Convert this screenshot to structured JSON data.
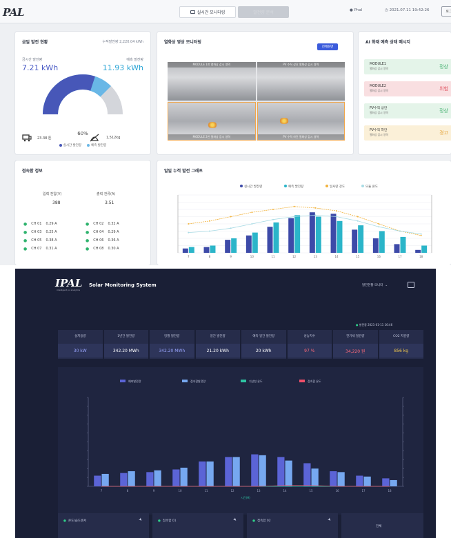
{
  "top": {
    "logo": "PAL",
    "tabs": [
      {
        "label": "실시간 모니터링",
        "active": true
      },
      {
        "label": "발전량 분석",
        "active": false
      }
    ],
    "user": "Phal",
    "datetime": "2021.07.11  19:42:26",
    "right_button": "로그",
    "generation": {
      "title": "금일 발전 현황",
      "total": "누적발전량 2,220.04 kWh",
      "current_label": "금시간 발전량",
      "current_value": "7.21 kWh",
      "predicted_label": "예측 발전량",
      "predicted_value": "11.93 kWh",
      "percent": "60%",
      "percent_value": 60,
      "legend": [
        "실시간 발전량",
        "예측 발전량"
      ],
      "co2": "23.38 톤",
      "tree": "1,512kg"
    },
    "camera": {
      "title": "열화상 영상 모니터링",
      "button": "전체화면",
      "cells": [
        "MODULE 1번 열화상 감시 영역",
        "PV 수직 상단 열화상 감시 영역",
        "MODULE 2번 열화상 감시 영역",
        "PV 수직 하단 열화상 감시 영역"
      ]
    },
    "ai": {
      "title": "AI 화재 예측 상태 메시지",
      "rows": [
        {
          "name": "MODULE1",
          "sub": "열화상 감시 영역",
          "state": "정상",
          "color": "#3fae6c",
          "bg": "#e4f4e9"
        },
        {
          "name": "MODULE2",
          "sub": "열화상 감시 영역",
          "state": "위험",
          "color": "#e05562",
          "bg": "#f9dfe1"
        },
        {
          "name": "PV수직 상단",
          "sub": "열화상 감시 영역",
          "state": "정상",
          "color": "#3fae6c",
          "bg": "#e4f4e9"
        },
        {
          "name": "PV수직 하단",
          "sub": "열화상 감시 영역",
          "state": "경고",
          "color": "#e5a43a",
          "bg": "#fbf0d8"
        }
      ]
    },
    "connection": {
      "title": "접속함 정보",
      "input_voltage_label": "입력 전압(V)",
      "input_voltage": "388",
      "output_current_label": "출력 전류(A)",
      "output_current": "3.51",
      "channels": [
        {
          "ch": "CH 01",
          "a": "0.29 A"
        },
        {
          "ch": "CH 02",
          "a": "0.32 A"
        },
        {
          "ch": "CH 03",
          "a": "0.25 A"
        },
        {
          "ch": "CH 04",
          "a": "0.29 A"
        },
        {
          "ch": "CH 05",
          "a": "0.38 A"
        },
        {
          "ch": "CH 06",
          "a": "0.36 A"
        },
        {
          "ch": "CH 07",
          "a": "0.31 A"
        },
        {
          "ch": "CH 08",
          "a": "0.30 A"
        }
      ]
    },
    "daily_chart_title": "일일 누적 발전 그래프"
  },
  "bottom": {
    "logo": "IPAL",
    "logo_sub": "intelligent pv analytics",
    "title": "Solar Monitoring System",
    "menu": "발전현황 모니터",
    "status": "발전중  2021-01-11  16:46",
    "stats": [
      {
        "label": "설치용량",
        "value": "30 kW",
        "color": "#9aa6ff"
      },
      {
        "label": "1년간 발전량",
        "value": "342.20 MWh",
        "color": "#ffffff"
      },
      {
        "label": "당월 발전량",
        "value": "342.20 MWh",
        "color": "#9aa6ff"
      },
      {
        "label": "일간 발전량",
        "value": "21.20 kWh",
        "color": "#ffffff"
      },
      {
        "label": "예측 일간 발전량",
        "value": "20 kWh",
        "color": "#ffffff"
      },
      {
        "label": "성능지수",
        "value": "97 %",
        "color": "#ff6a7a"
      },
      {
        "label": "전기세 절감량",
        "value": "34,220 원",
        "color": "#ff6a7a"
      },
      {
        "label": "CO2 저감량",
        "value": "856 kg",
        "color": "#f2c94c"
      }
    ],
    "footer": [
      {
        "label": "온도/습도센서"
      },
      {
        "label": "접속함 01"
      },
      {
        "label": "접속함 02"
      },
      {
        "label": "전체"
      }
    ]
  },
  "chart_data": [
    {
      "type": "bar",
      "title": "일일 누적 발전 그래프",
      "categories": [
        "7",
        "8",
        "9",
        "10",
        "11",
        "12",
        "13",
        "14",
        "15",
        "16",
        "17",
        "18"
      ],
      "legend": [
        "실시간 발전량",
        "예측 발전량",
        "일사량 강도",
        "모듈 온도"
      ],
      "series": [
        {
          "name": "실시간 발전량",
          "values": [
            3,
            4,
            9,
            12,
            18,
            24,
            28,
            27,
            16,
            10,
            6,
            2
          ],
          "color": "#3d4aa8"
        },
        {
          "name": "예측 발전량",
          "values": [
            4,
            5,
            10,
            14,
            21,
            26,
            25,
            22,
            19,
            15,
            11,
            5
          ],
          "color": "#2bb5c9"
        },
        {
          "name": "일사량 강도",
          "values": [
            20,
            22,
            25,
            28,
            30,
            32,
            31,
            29,
            25,
            20,
            15,
            12
          ],
          "color": "#f2b33d"
        },
        {
          "name": "모듈 온도",
          "values": [
            14,
            15,
            17,
            20,
            23,
            25,
            26,
            25,
            22,
            18,
            15,
            13
          ],
          "color": "#a9dbe5"
        }
      ],
      "ylim": [
        0,
        40
      ]
    },
    {
      "type": "bar",
      "categories": [
        "7",
        "8",
        "9",
        "10",
        "11",
        "12",
        "13",
        "14",
        "15",
        "16",
        "17",
        "18"
      ],
      "xlabel": "시간(H)",
      "legend": [
        "예측발전량",
        "접속함발전량",
        "기상청 온도",
        "접속함 온도"
      ],
      "series": [
        {
          "name": "예측발전량",
          "values": [
            1.2,
            1.5,
            1.6,
            1.9,
            2.8,
            3.3,
            3.6,
            3.3,
            2.6,
            1.7,
            1.2,
            0.9
          ],
          "color": "#5b64d6"
        },
        {
          "name": "접속함발전량",
          "values": [
            1.4,
            1.7,
            1.8,
            2.1,
            2.8,
            3.3,
            3.5,
            2.9,
            2.0,
            1.6,
            1.1,
            0.7
          ],
          "color": "#76a8f0"
        },
        {
          "name": "기상청 온도",
          "values": [
            0,
            0,
            0,
            0,
            0,
            0,
            0,
            0,
            0,
            0,
            0,
            0
          ],
          "color": "#2ec4a3"
        },
        {
          "name": "접속함 온도",
          "values": [
            0,
            0,
            0,
            0,
            0,
            0,
            0,
            0.1,
            0.1,
            0,
            0,
            0
          ],
          "color": "#ef4f6a"
        }
      ],
      "ylim": [
        0,
        10
      ],
      "y2lim": [
        0,
        10
      ]
    }
  ]
}
